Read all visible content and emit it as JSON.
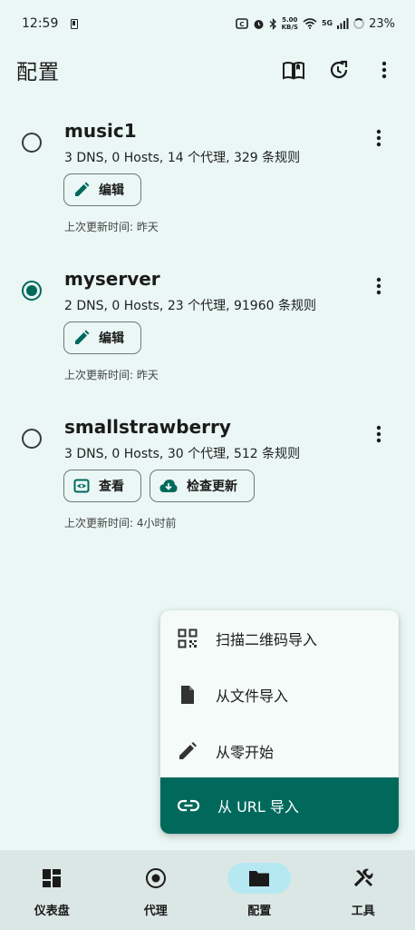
{
  "status_bar": {
    "time": "12:59",
    "net_speed_value": "5.00",
    "net_speed_unit": "KB/S",
    "network": "5G",
    "battery": "23%"
  },
  "app_bar": {
    "title": "配置",
    "actions": [
      "book-icon",
      "history-icon",
      "more-vert-icon"
    ]
  },
  "profiles": [
    {
      "name": "music1",
      "stats": "3 DNS, 0 Hosts, 14 个代理, 329 条规则",
      "selected": false,
      "buttons": [
        {
          "label": "编辑",
          "icon": "edit-icon"
        }
      ],
      "updated": "上次更新时间: 昨天"
    },
    {
      "name": "myserver",
      "stats": "2 DNS, 0 Hosts, 23 个代理, 91960 条规则",
      "selected": true,
      "buttons": [
        {
          "label": "编辑",
          "icon": "edit-icon"
        }
      ],
      "updated": "上次更新时间: 昨天"
    },
    {
      "name": "smallstrawberry",
      "stats": "3 DNS, 0 Hosts, 30 个代理, 512 条规则",
      "selected": false,
      "buttons": [
        {
          "label": "查看",
          "icon": "view-icon"
        },
        {
          "label": "检查更新",
          "icon": "cloud-download-icon"
        }
      ],
      "updated": "上次更新时间: 4小时前"
    }
  ],
  "import_menu": {
    "items": [
      {
        "label": "扫描二维码导入",
        "icon": "qr-code-icon"
      },
      {
        "label": "从文件导入",
        "icon": "file-icon"
      },
      {
        "label": "从零开始",
        "icon": "pencil-icon"
      },
      {
        "label": "从 URL 导入",
        "icon": "link-icon",
        "active": true
      }
    ]
  },
  "bottom_nav": {
    "items": [
      {
        "label": "仪表盘",
        "icon": "dashboard-icon"
      },
      {
        "label": "代理",
        "icon": "proxy-icon"
      },
      {
        "label": "配置",
        "icon": "folder-icon",
        "active": true
      },
      {
        "label": "工具",
        "icon": "tools-icon"
      }
    ]
  },
  "colors": {
    "background": "#eaf7f5",
    "primary": "#00695c",
    "nav_background": "#dbe7e5",
    "nav_active_pill": "#b6e8f2"
  }
}
